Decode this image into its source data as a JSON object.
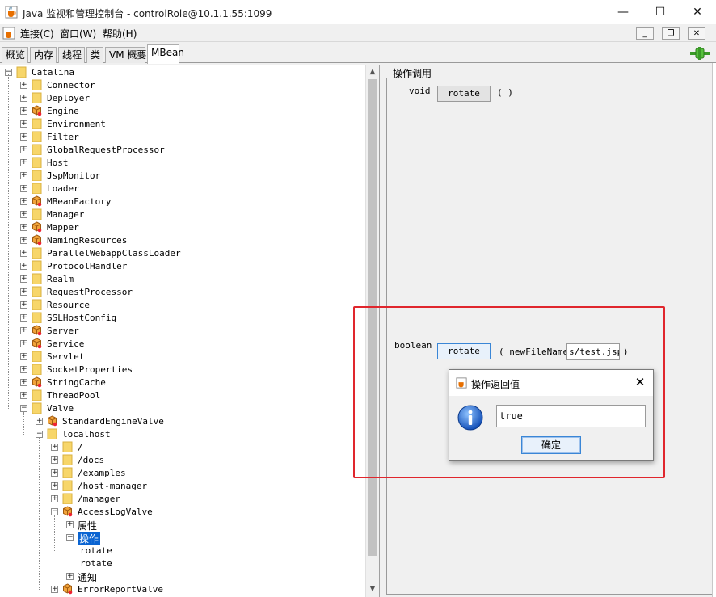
{
  "window": {
    "title": "Java 监视和管理控制台 - controlRole@10.1.1.55:1099",
    "minimize_glyph": "—",
    "maximize_glyph": "☐",
    "close_glyph": "✕",
    "icon": "java-cup-icon"
  },
  "menu": {
    "items": [
      "连接(C)",
      "窗口(W)",
      "帮助(H)"
    ],
    "mdi_minimize": "_",
    "mdi_restore": "❐",
    "mdi_close": "✕"
  },
  "tabs": [
    {
      "label": "概览",
      "active": false
    },
    {
      "label": "内存",
      "active": false
    },
    {
      "label": "线程",
      "active": false
    },
    {
      "label": "类",
      "active": false
    },
    {
      "label": "VM 概要",
      "active": false
    },
    {
      "label": "MBean",
      "active": true
    }
  ],
  "tree": {
    "root": "Catalina",
    "level1": [
      {
        "label": "Connector",
        "icon": "folder"
      },
      {
        "label": "Deployer",
        "icon": "folder"
      },
      {
        "label": "Engine",
        "icon": "bean"
      },
      {
        "label": "Environment",
        "icon": "folder"
      },
      {
        "label": "Filter",
        "icon": "folder"
      },
      {
        "label": "GlobalRequestProcessor",
        "icon": "folder"
      },
      {
        "label": "Host",
        "icon": "folder"
      },
      {
        "label": "JspMonitor",
        "icon": "folder"
      },
      {
        "label": "Loader",
        "icon": "folder"
      },
      {
        "label": "MBeanFactory",
        "icon": "bean"
      },
      {
        "label": "Manager",
        "icon": "folder"
      },
      {
        "label": "Mapper",
        "icon": "bean"
      },
      {
        "label": "NamingResources",
        "icon": "bean"
      },
      {
        "label": "ParallelWebappClassLoader",
        "icon": "folder"
      },
      {
        "label": "ProtocolHandler",
        "icon": "folder"
      },
      {
        "label": "Realm",
        "icon": "folder"
      },
      {
        "label": "RequestProcessor",
        "icon": "folder"
      },
      {
        "label": "Resource",
        "icon": "folder"
      },
      {
        "label": "SSLHostConfig",
        "icon": "folder"
      },
      {
        "label": "Server",
        "icon": "bean"
      },
      {
        "label": "Service",
        "icon": "bean"
      },
      {
        "label": "Servlet",
        "icon": "folder"
      },
      {
        "label": "SocketProperties",
        "icon": "folder"
      },
      {
        "label": "StringCache",
        "icon": "bean"
      },
      {
        "label": "ThreadPool",
        "icon": "folder"
      },
      {
        "label": "Valve",
        "icon": "folder"
      }
    ],
    "valve_children": [
      {
        "label": "StandardEngineValve",
        "icon": "bean"
      },
      {
        "label": "localhost",
        "icon": "folder"
      }
    ],
    "localhost_children": [
      {
        "label": "/",
        "icon": "folder"
      },
      {
        "label": "/docs",
        "icon": "folder"
      },
      {
        "label": "/examples",
        "icon": "folder"
      },
      {
        "label": "/host-manager",
        "icon": "folder"
      },
      {
        "label": "/manager",
        "icon": "folder"
      },
      {
        "label": "AccessLogValve",
        "icon": "bean"
      }
    ],
    "accesslog_children": [
      "属性",
      "操作",
      "通知"
    ],
    "operations": [
      "rotate",
      "rotate"
    ],
    "last_visible": {
      "label": "ErrorReportValve",
      "icon": "bean"
    },
    "selected": "操作"
  },
  "operations_panel": {
    "group_title": "操作调用",
    "op1": {
      "return_type": "void",
      "button": "rotate",
      "params": "( )"
    },
    "op2": {
      "return_type": "boolean",
      "button": "rotate",
      "open_paren": "( newFileName",
      "param_value": "s/test.jsp",
      "close_paren": ")"
    }
  },
  "dialog": {
    "title": "操作返回值",
    "result": "true",
    "ok_button": "确定",
    "close_glyph": "✕",
    "icon": "info-icon"
  },
  "colors": {
    "selection": "#0a64d2",
    "highlight_box": "#e0262d",
    "folder": "#f7d66a"
  }
}
